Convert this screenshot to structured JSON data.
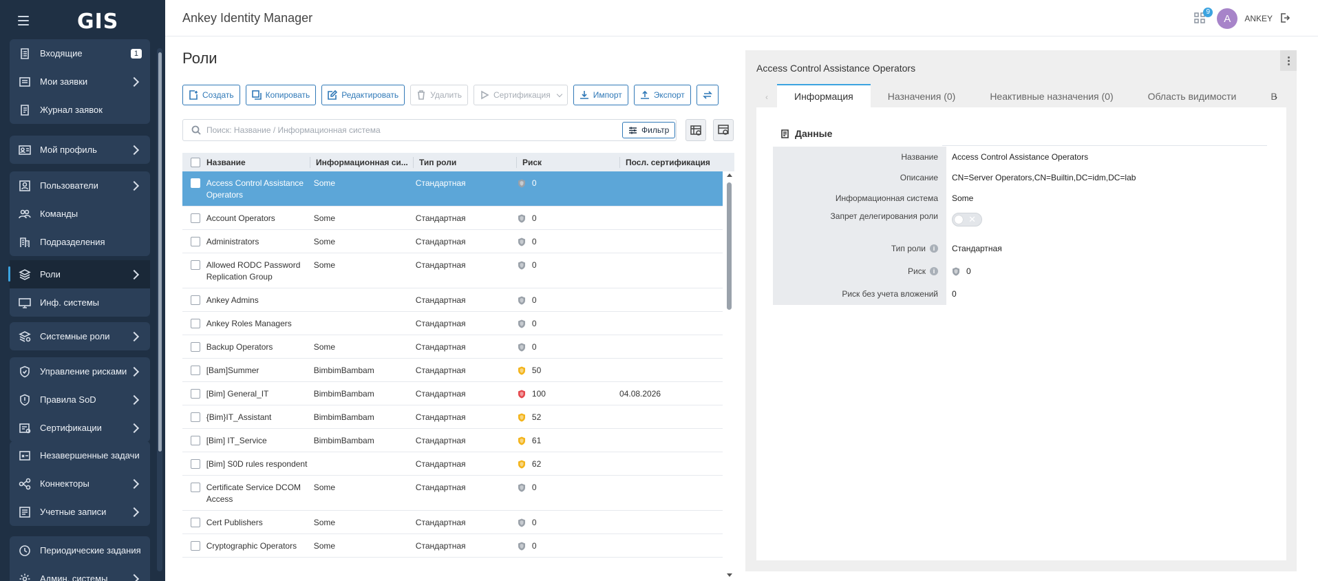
{
  "header": {
    "logo": "GIS",
    "app_title": "Ankey Identity Manager",
    "notifications_count": "9",
    "avatar_letter": "A",
    "username": "ANKEY"
  },
  "sidebar": {
    "groups": [
      {
        "items": [
          {
            "label": "Входящие",
            "icon": "inbox-list-icon",
            "badge": "1"
          },
          {
            "label": "Мои заявки",
            "icon": "requests-icon",
            "chevron": true
          },
          {
            "label": "Журнал заявок",
            "icon": "journal-icon"
          }
        ]
      },
      {
        "items": [
          {
            "label": "Мой профиль",
            "icon": "profile-card-icon",
            "chevron": true
          }
        ]
      },
      {
        "items": [
          {
            "label": "Пользователи",
            "icon": "user-icon",
            "chevron": true
          },
          {
            "label": "Команды",
            "icon": "team-icon"
          },
          {
            "label": "Подразделения",
            "icon": "building-icon"
          }
        ]
      },
      {
        "items": [
          {
            "label": "Роли",
            "icon": "roles-icon",
            "chevron": true,
            "active": true
          },
          {
            "label": "Инф. системы",
            "icon": "monitor-icon"
          }
        ]
      },
      {
        "items": [
          {
            "label": "Системные роли",
            "icon": "system-roles-icon",
            "chevron": true
          }
        ]
      },
      {
        "items": [
          {
            "label": "Управление рисками",
            "icon": "shield-icon",
            "chevron": true
          },
          {
            "label": "Правила SoD",
            "icon": "sod-rules-icon",
            "chevron": true
          },
          {
            "label": "Сертификации",
            "icon": "certification-icon",
            "chevron": true
          }
        ]
      },
      {
        "items": [
          {
            "label": "Незавершенные задачи",
            "icon": "pending-tasks-icon"
          },
          {
            "label": "Коннекторы",
            "icon": "connector-icon",
            "chevron": true
          },
          {
            "label": "Учетные записи",
            "icon": "accounts-icon",
            "chevron": true
          }
        ]
      },
      {
        "items": [
          {
            "label": "Периодические задания",
            "icon": "clock-icon"
          },
          {
            "label": "Админ. системы",
            "icon": "gear-icon",
            "chevron": true
          }
        ]
      }
    ]
  },
  "main": {
    "page_title": "Роли",
    "toolbar": {
      "create": "Создать",
      "copy": "Копировать",
      "edit": "Редактировать",
      "delete": "Удалить",
      "certification": "Сертификация",
      "import": "Импорт",
      "export": "Экспорт"
    },
    "search": {
      "placeholder": "Поиск: Название / Информационная система",
      "value": ""
    },
    "filter_label": "Фильтр",
    "table": {
      "columns": [
        "Название",
        "Информационная си...",
        "Тип роли",
        "Риск",
        "Посл. сертификация"
      ],
      "rows": [
        {
          "name": "Access Control Assistance Operators",
          "system": "Some",
          "type": "Стандартная",
          "risk": "0",
          "risk_color": "#9aa1a9",
          "cert": "",
          "selected": true
        },
        {
          "name": "Account Operators",
          "system": "Some",
          "type": "Стандартная",
          "risk": "0",
          "risk_color": "#9aa1a9",
          "cert": ""
        },
        {
          "name": "Administrators",
          "system": "Some",
          "type": "Стандартная",
          "risk": "0",
          "risk_color": "#9aa1a9",
          "cert": ""
        },
        {
          "name": "Allowed RODC Password Replication Group",
          "system": "Some",
          "type": "Стандартная",
          "risk": "0",
          "risk_color": "#9aa1a9",
          "cert": ""
        },
        {
          "name": "Ankey Admins",
          "system": "",
          "type": "Стандартная",
          "risk": "0",
          "risk_color": "#9aa1a9",
          "cert": ""
        },
        {
          "name": "Ankey Roles Managers",
          "system": "",
          "type": "Стандартная",
          "risk": "0",
          "risk_color": "#9aa1a9",
          "cert": ""
        },
        {
          "name": "Backup Operators",
          "system": "Some",
          "type": "Стандартная",
          "risk": "0",
          "risk_color": "#9aa1a9",
          "cert": ""
        },
        {
          "name": "[Bam]Summer",
          "system": "BimbimBambam",
          "type": "Стандартная",
          "risk": "50",
          "risk_color": "#f3b41b",
          "cert": ""
        },
        {
          "name": "[Bim] General_IT",
          "system": "BimbimBambam",
          "type": "Стандартная",
          "risk": "100",
          "risk_color": "#e5484d",
          "cert": "04.08.2026"
        },
        {
          "name": "{Bim}IT_Assistant",
          "system": "BimbimBambam",
          "type": "Стандартная",
          "risk": "52",
          "risk_color": "#f3b41b",
          "cert": ""
        },
        {
          "name": "[Bim] IT_Service",
          "system": "BimbimBambam",
          "type": "Стандартная",
          "risk": "61",
          "risk_color": "#f3b41b",
          "cert": ""
        },
        {
          "name": "[Bim] S0D rules respondent",
          "system": "",
          "type": "Стандартная",
          "risk": "62",
          "risk_color": "#f3b41b",
          "cert": ""
        },
        {
          "name": "Certificate Service DCOM Access",
          "system": "Some",
          "type": "Стандартная",
          "risk": "0",
          "risk_color": "#9aa1a9",
          "cert": ""
        },
        {
          "name": "Cert Publishers",
          "system": "Some",
          "type": "Стандартная",
          "risk": "0",
          "risk_color": "#9aa1a9",
          "cert": ""
        },
        {
          "name": "Cryptographic Operators",
          "system": "Some",
          "type": "Стандартная",
          "risk": "0",
          "risk_color": "#9aa1a9",
          "cert": ""
        }
      ]
    }
  },
  "detail": {
    "title": "Access Control Assistance Operators",
    "tabs": [
      "Информация",
      "Назначения (0)",
      "Неактивные назначения (0)",
      "Область видимости",
      "В"
    ],
    "section_title": "Данные",
    "fields": {
      "name_label": "Название",
      "name_value": "Access Control Assistance Operators",
      "desc_label": "Описание",
      "desc_value": "CN=Server Operators,CN=Builtin,DC=idm,DC=lab",
      "system_label": "Информационная система",
      "system_value": "Some",
      "delegation_label": "Запрет делегирования роли",
      "delegation_on": false,
      "type_label": "Тип роли",
      "type_value": "Стандартная",
      "risk_label": "Риск",
      "risk_value": "0",
      "risk_nested_label": "Риск без учета вложений",
      "risk_nested_value": "0"
    }
  },
  "colors": {
    "sidebar_bg": "#1f3044",
    "sidebar_group": "#2b3f58",
    "accent": "#2f78b7",
    "selected_row": "#5ca6d8",
    "risk_gray": "#9aa1a9",
    "risk_yellow": "#f3b41b",
    "risk_red": "#e5484d"
  }
}
